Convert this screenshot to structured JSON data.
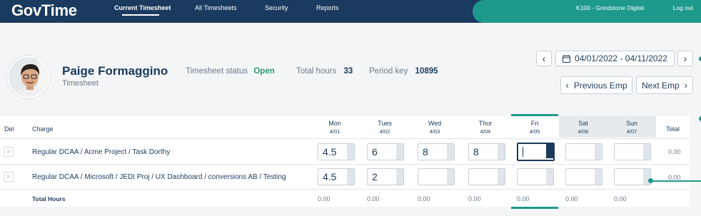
{
  "header": {
    "logo": "GovTime",
    "nav": [
      {
        "label": "Current Timesheet",
        "active": true
      },
      {
        "label": "All Timesheets",
        "active": false
      },
      {
        "label": "Security",
        "active": false
      },
      {
        "label": "Reports",
        "active": false
      }
    ],
    "company": "K100 - Grindstone Digital",
    "logout": "Log out"
  },
  "employee": {
    "name": "Paige Formaggino",
    "subtitle": "Timesheet",
    "status_label": "Timesheet status",
    "status_value": "Open",
    "hours_label": "Total hours",
    "hours_value": "33",
    "period_label": "Period key",
    "period_value": "10895"
  },
  "period": {
    "prev": "‹",
    "next": "›",
    "range": "04/01/2022 - 04/11/2022",
    "prev_emp": "Previous Emp",
    "next_emp": "Next Emp"
  },
  "table": {
    "col_del": "Del",
    "col_charge": "Charge",
    "col_total": "Total",
    "days": [
      {
        "day": "Mon",
        "date": "4/01"
      },
      {
        "day": "Tues",
        "date": "4/02"
      },
      {
        "day": "Wed",
        "date": "4/03"
      },
      {
        "day": "Thur",
        "date": "4/04"
      },
      {
        "day": "Fri",
        "date": "4/05"
      },
      {
        "day": "Sat",
        "date": "4/06"
      },
      {
        "day": "Sun",
        "date": "4/07"
      }
    ],
    "rows": [
      {
        "charge": "Regular DCAA / Acme Project / Task Dorthy",
        "hours": [
          "4.5",
          "6",
          "8",
          "8",
          "",
          "",
          ""
        ],
        "total": "0.00"
      },
      {
        "charge": "Regular DCAA / Microsoft / JEDI Proj / UX Dashboard / conversions AB / Testing",
        "hours": [
          "4.5",
          "2",
          "",
          "",
          "",
          "",
          ""
        ],
        "total": "0.00"
      }
    ],
    "totals_label": "Total Hours",
    "totals": [
      "0.00",
      "0.00",
      "0.00",
      "0.00",
      "0.00",
      "0.00",
      "0.00"
    ],
    "del_symbol": "✕"
  },
  "colors": {
    "navy": "#1b3a5f",
    "teal": "#1d9a8c",
    "status_open": "#2d9a6e"
  }
}
